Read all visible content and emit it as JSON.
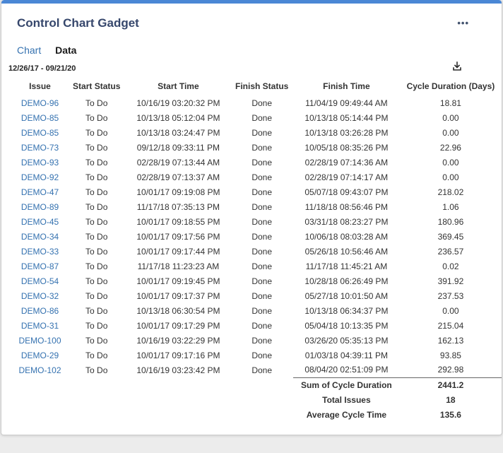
{
  "card": {
    "title": "Control Chart Gadget",
    "tabs": [
      {
        "label": "Chart",
        "active": false
      },
      {
        "label": "Data",
        "active": true
      }
    ],
    "date_range": "12/26/17 - 09/21/20"
  },
  "icons": {
    "menu": "•••",
    "download": "download-icon"
  },
  "colors": {
    "accent_bar": "#4a87d5",
    "link": "#3572b0",
    "title": "#36476c",
    "text": "#333333"
  },
  "table": {
    "headers": [
      "Issue",
      "Start Status",
      "Start Time",
      "Finish Status",
      "Finish Time",
      "Cycle Duration (Days)"
    ],
    "rows": [
      [
        "DEMO-96",
        "To Do",
        "10/16/19 03:20:32 PM",
        "Done",
        "11/04/19 09:49:44 AM",
        "18.81"
      ],
      [
        "DEMO-85",
        "To Do",
        "10/13/18 05:12:04 PM",
        "Done",
        "10/13/18 05:14:44 PM",
        "0.00"
      ],
      [
        "DEMO-85",
        "To Do",
        "10/13/18 03:24:47 PM",
        "Done",
        "10/13/18 03:26:28 PM",
        "0.00"
      ],
      [
        "DEMO-73",
        "To Do",
        "09/12/18 09:33:11 PM",
        "Done",
        "10/05/18 08:35:26 PM",
        "22.96"
      ],
      [
        "DEMO-93",
        "To Do",
        "02/28/19 07:13:44 AM",
        "Done",
        "02/28/19 07:14:36 AM",
        "0.00"
      ],
      [
        "DEMO-92",
        "To Do",
        "02/28/19 07:13:37 AM",
        "Done",
        "02/28/19 07:14:17 AM",
        "0.00"
      ],
      [
        "DEMO-47",
        "To Do",
        "10/01/17 09:19:08 PM",
        "Done",
        "05/07/18 09:43:07 PM",
        "218.02"
      ],
      [
        "DEMO-89",
        "To Do",
        "11/17/18 07:35:13 PM",
        "Done",
        "11/18/18 08:56:46 PM",
        "1.06"
      ],
      [
        "DEMO-45",
        "To Do",
        "10/01/17 09:18:55 PM",
        "Done",
        "03/31/18 08:23:27 PM",
        "180.96"
      ],
      [
        "DEMO-34",
        "To Do",
        "10/01/17 09:17:56 PM",
        "Done",
        "10/06/18 08:03:28 AM",
        "369.45"
      ],
      [
        "DEMO-33",
        "To Do",
        "10/01/17 09:17:44 PM",
        "Done",
        "05/26/18 10:56:46 AM",
        "236.57"
      ],
      [
        "DEMO-87",
        "To Do",
        "11/17/18 11:23:23 AM",
        "Done",
        "11/17/18 11:45:21 AM",
        "0.02"
      ],
      [
        "DEMO-54",
        "To Do",
        "10/01/17 09:19:45 PM",
        "Done",
        "10/28/18 06:26:49 PM",
        "391.92"
      ],
      [
        "DEMO-32",
        "To Do",
        "10/01/17 09:17:37 PM",
        "Done",
        "05/27/18 10:01:50 AM",
        "237.53"
      ],
      [
        "DEMO-86",
        "To Do",
        "10/13/18 06:30:54 PM",
        "Done",
        "10/13/18 06:34:37 PM",
        "0.00"
      ],
      [
        "DEMO-31",
        "To Do",
        "10/01/17 09:17:29 PM",
        "Done",
        "05/04/18 10:13:35 PM",
        "215.04"
      ],
      [
        "DEMO-100",
        "To Do",
        "10/16/19 03:22:29 PM",
        "Done",
        "03/26/20 05:35:13 PM",
        "162.13"
      ],
      [
        "DEMO-29",
        "To Do",
        "10/01/17 09:17:16 PM",
        "Done",
        "01/03/18 04:39:11 PM",
        "93.85"
      ],
      [
        "DEMO-102",
        "To Do",
        "10/16/19 03:23:42 PM",
        "Done",
        "08/04/20 02:51:09 PM",
        "292.98"
      ]
    ],
    "summary": [
      {
        "label": "Sum of Cycle Duration",
        "value": "2441.2"
      },
      {
        "label": "Total Issues",
        "value": "18"
      },
      {
        "label": "Average Cycle Time",
        "value": "135.6"
      }
    ]
  }
}
